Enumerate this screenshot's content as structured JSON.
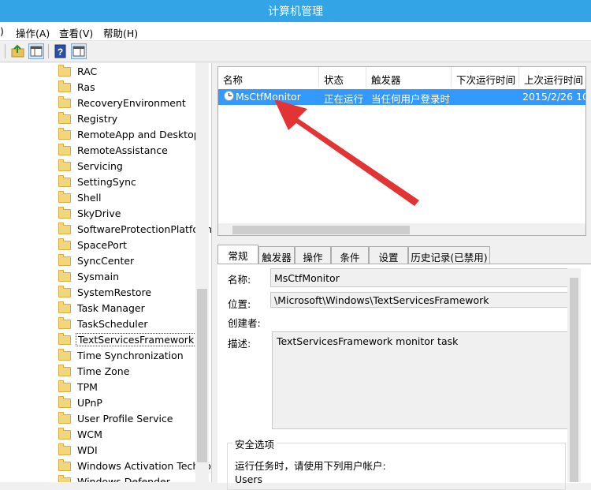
{
  "window": {
    "title": "计算机管理"
  },
  "menu": {
    "items": [
      ")",
      "操作(A)",
      "查看(V)",
      "帮助(H)"
    ]
  },
  "tree": {
    "items": [
      "RAC",
      "Ras",
      "RecoveryEnvironment",
      "Registry",
      "RemoteApp and Desktop",
      "RemoteAssistance",
      "Servicing",
      "SettingSync",
      "Shell",
      "SkyDrive",
      "SoftwareProtectionPlatform",
      "SpacePort",
      "SyncCenter",
      "Sysmain",
      "SystemRestore",
      "Task Manager",
      "TaskScheduler",
      "TextServicesFramework",
      "Time Synchronization",
      "Time Zone",
      "TPM",
      "UPnP",
      "User Profile Service",
      "WCM",
      "WDI",
      "Windows Activation Technologies",
      "Windows Defender"
    ],
    "selected": "TextServicesFramework"
  },
  "tasklist": {
    "columns": [
      "名称",
      "状态",
      "触发器",
      "下次运行时间",
      "上次运行时间"
    ],
    "rows": [
      {
        "name": "MsCtfMonitor",
        "status": "正在运行",
        "trigger": "当任何用户登录时",
        "next_run": "",
        "last_run": "2015/2/26 10"
      }
    ]
  },
  "tabs": [
    "常规",
    "触发器",
    "操作",
    "条件",
    "设置",
    "历史记录(已禁用)"
  ],
  "general": {
    "name_label": "名称:",
    "name_value": "MsCtfMonitor",
    "location_label": "位置:",
    "location_value": "\\Microsoft\\Windows\\TextServicesFramework",
    "author_label": "创建者:",
    "description_label": "描述:",
    "description_value": "TextServicesFramework monitor task",
    "security_title": "安全选项",
    "security_text": "运行任务时，请使用下列用户帐户:",
    "security_user": "Users"
  }
}
